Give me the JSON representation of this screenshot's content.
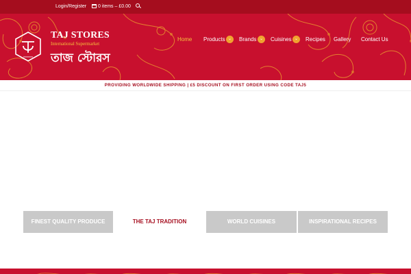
{
  "topbar": {
    "login_label": "Login/Register",
    "cart_label": "0 items – £0.00",
    "cart_icon": "cart-icon",
    "search_icon": "search-icon"
  },
  "brand": {
    "name": "TAJ STORES",
    "tagline": "International Supermarket",
    "bengali": "তাজ স্টোরস"
  },
  "nav": {
    "items": [
      {
        "label": "Home",
        "active": true
      },
      {
        "label": "Products",
        "dropdown": true
      },
      {
        "label": "Brands",
        "dropdown": true
      },
      {
        "label": "Cuisines",
        "dropdown": true
      },
      {
        "label": "Recipes"
      },
      {
        "label": "Gallery"
      },
      {
        "label": "Contact Us"
      }
    ],
    "dropdown_glyph": "⌄"
  },
  "promo": {
    "text": "PROVIDING WORLDWIDE SHIPPING | £5 DISCOUNT ON FIRST ORDER USING CODE TAJ5"
  },
  "tabs": [
    {
      "label": "FINEST QUALITY PRODUCE"
    },
    {
      "label": "THE TAJ TRADITION",
      "selected": true
    },
    {
      "label": "WORLD CUISINES"
    },
    {
      "label": "INSPIRATIONAL RECIPES"
    }
  ],
  "colors": {
    "brand_red": "#c8102e",
    "dark_red": "#a50d1e",
    "gold": "#f6c23c",
    "tab_grey": "#c9c9c9"
  }
}
